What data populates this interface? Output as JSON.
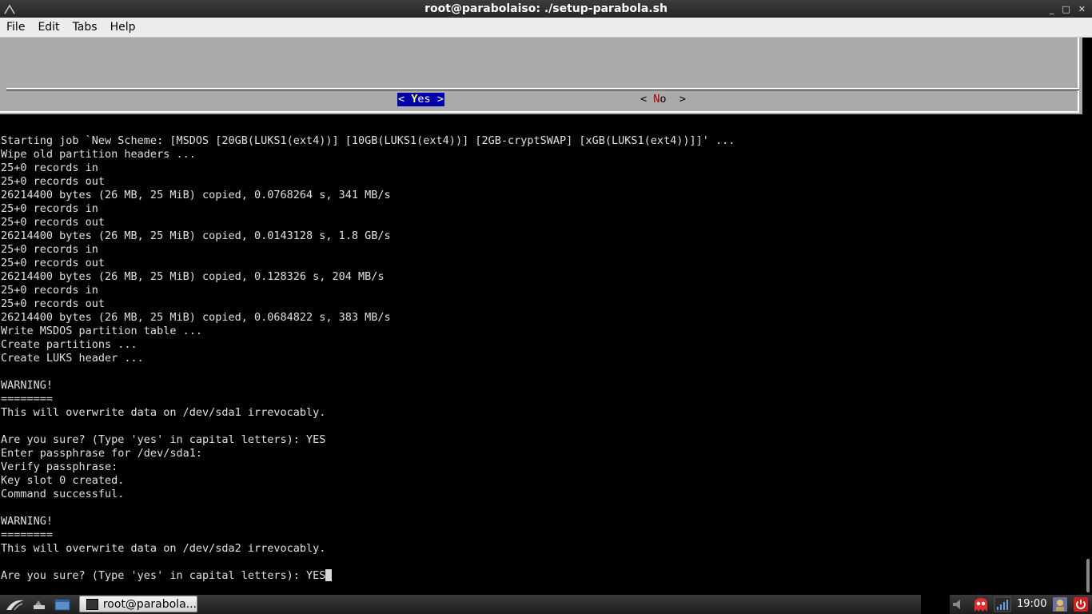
{
  "window": {
    "title": "root@parabolaiso: ./setup-parabola.sh",
    "controls": [
      "_",
      "□",
      "✕"
    ]
  },
  "menu": [
    "File",
    "Edit",
    "Tabs",
    "Help"
  ],
  "dialog": {
    "yes": {
      "open": "< ",
      "hot": "Y",
      "rest": "es",
      "close": " >"
    },
    "no": {
      "open": "< ",
      "hot": "N",
      "rest": "o",
      "close": "  >"
    }
  },
  "terminal_lines": [
    "Starting job `New Scheme: [MSDOS [20GB(LUKS1(ext4))] [10GB(LUKS1(ext4))] [2GB-cryptSWAP] [xGB(LUKS1(ext4))]]' ...",
    "Wipe old partition headers ...",
    "25+0 records in",
    "25+0 records out",
    "26214400 bytes (26 MB, 25 MiB) copied, 0.0768264 s, 341 MB/s",
    "25+0 records in",
    "25+0 records out",
    "26214400 bytes (26 MB, 25 MiB) copied, 0.0143128 s, 1.8 GB/s",
    "25+0 records in",
    "25+0 records out",
    "26214400 bytes (26 MB, 25 MiB) copied, 0.128326 s, 204 MB/s",
    "25+0 records in",
    "25+0 records out",
    "26214400 bytes (26 MB, 25 MiB) copied, 0.0684822 s, 383 MB/s",
    "Write MSDOS partition table ...",
    "Create partitions ...",
    "Create LUKS header ...",
    "",
    "WARNING!",
    "========",
    "This will overwrite data on /dev/sda1 irrevocably.",
    "",
    "Are you sure? (Type 'yes' in capital letters): YES",
    "Enter passphrase for /dev/sda1:",
    "Verify passphrase:",
    "Key slot 0 created.",
    "Command successful.",
    "",
    "WARNING!",
    "========",
    "This will overwrite data on /dev/sda2 irrevocably.",
    ""
  ],
  "prompt_line": "Are you sure? (Type 'yes' in capital letters): YES",
  "taskbar": {
    "task_label": "root@parabola...",
    "clock": "19:00"
  },
  "colors": {
    "dialog_bg": "#aaaaaa",
    "button_selected_bg": "#0000aa",
    "hotkey_selected": "#ffff55",
    "hotkey": "#aa0000"
  },
  "icons": [
    "parabola-logo-icon",
    "show-desktop-icon",
    "file-manager-icon",
    "terminal-icon",
    "ghost-icon",
    "network-signal-icon",
    "volume-icon",
    "power-icon"
  ]
}
